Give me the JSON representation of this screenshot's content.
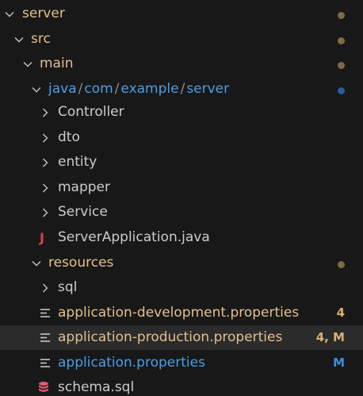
{
  "explorer": {
    "rows": {
      "server": {
        "label": "server"
      },
      "src": {
        "label": "src"
      },
      "main": {
        "label": "main"
      },
      "package": {
        "segments": [
          "java",
          "com",
          "example",
          "server"
        ],
        "separator": "/"
      },
      "controller": {
        "label": "Controller"
      },
      "dto": {
        "label": "dto"
      },
      "entity": {
        "label": "entity"
      },
      "mapper": {
        "label": "mapper"
      },
      "service": {
        "label": "Service"
      },
      "server_application": {
        "label": "ServerApplication.java",
        "icon": "java-icon",
        "icon_glyph": "J"
      },
      "resources": {
        "label": "resources"
      },
      "sql": {
        "label": "sql"
      },
      "app_dev": {
        "label": "application-development.properties",
        "badge": "4"
      },
      "app_prod": {
        "label": "application-production.properties",
        "badge": "4, M"
      },
      "app_props": {
        "label": "application.properties",
        "badge": "M"
      },
      "schema": {
        "label": "schema.sql",
        "icon": "database-icon"
      }
    }
  },
  "colors": {
    "modified": "#e2c08d",
    "blue": "#4a9fe6",
    "java": "#d74350",
    "database": "#e05a6e"
  }
}
